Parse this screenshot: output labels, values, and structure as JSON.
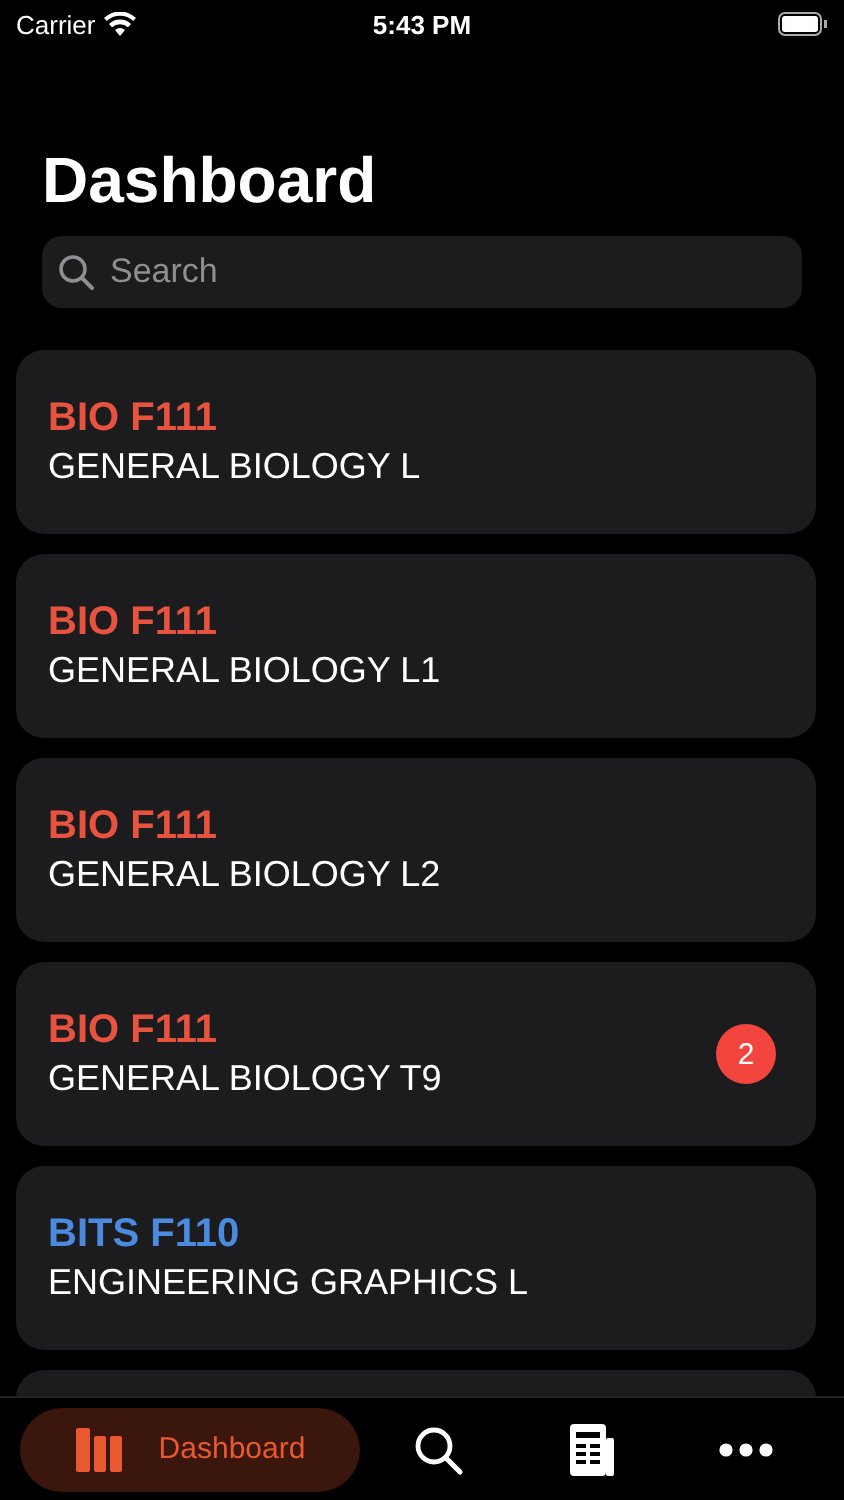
{
  "status_bar": {
    "carrier": "Carrier",
    "time": "5:43 PM"
  },
  "title": "Dashboard",
  "search": {
    "placeholder": "Search"
  },
  "courses": [
    {
      "code": "BIO F111",
      "name": "GENERAL BIOLOGY L",
      "color": "#e8533f"
    },
    {
      "code": "BIO F111",
      "name": "GENERAL BIOLOGY L1",
      "color": "#e8533f"
    },
    {
      "code": "BIO F111",
      "name": "GENERAL BIOLOGY L2",
      "color": "#e8533f"
    },
    {
      "code": "BIO F111",
      "name": "GENERAL BIOLOGY T9",
      "color": "#e8533f",
      "badge": "2"
    },
    {
      "code": "BITS F110",
      "name": "ENGINEERING GRAPHICS L",
      "color": "#4a8be0"
    }
  ],
  "tab_bar": [
    {
      "kind": "books",
      "label": "Dashboard",
      "selected": true
    },
    {
      "kind": "search",
      "selected": false
    },
    {
      "kind": "news",
      "selected": false
    },
    {
      "kind": "more",
      "selected": false
    }
  ]
}
